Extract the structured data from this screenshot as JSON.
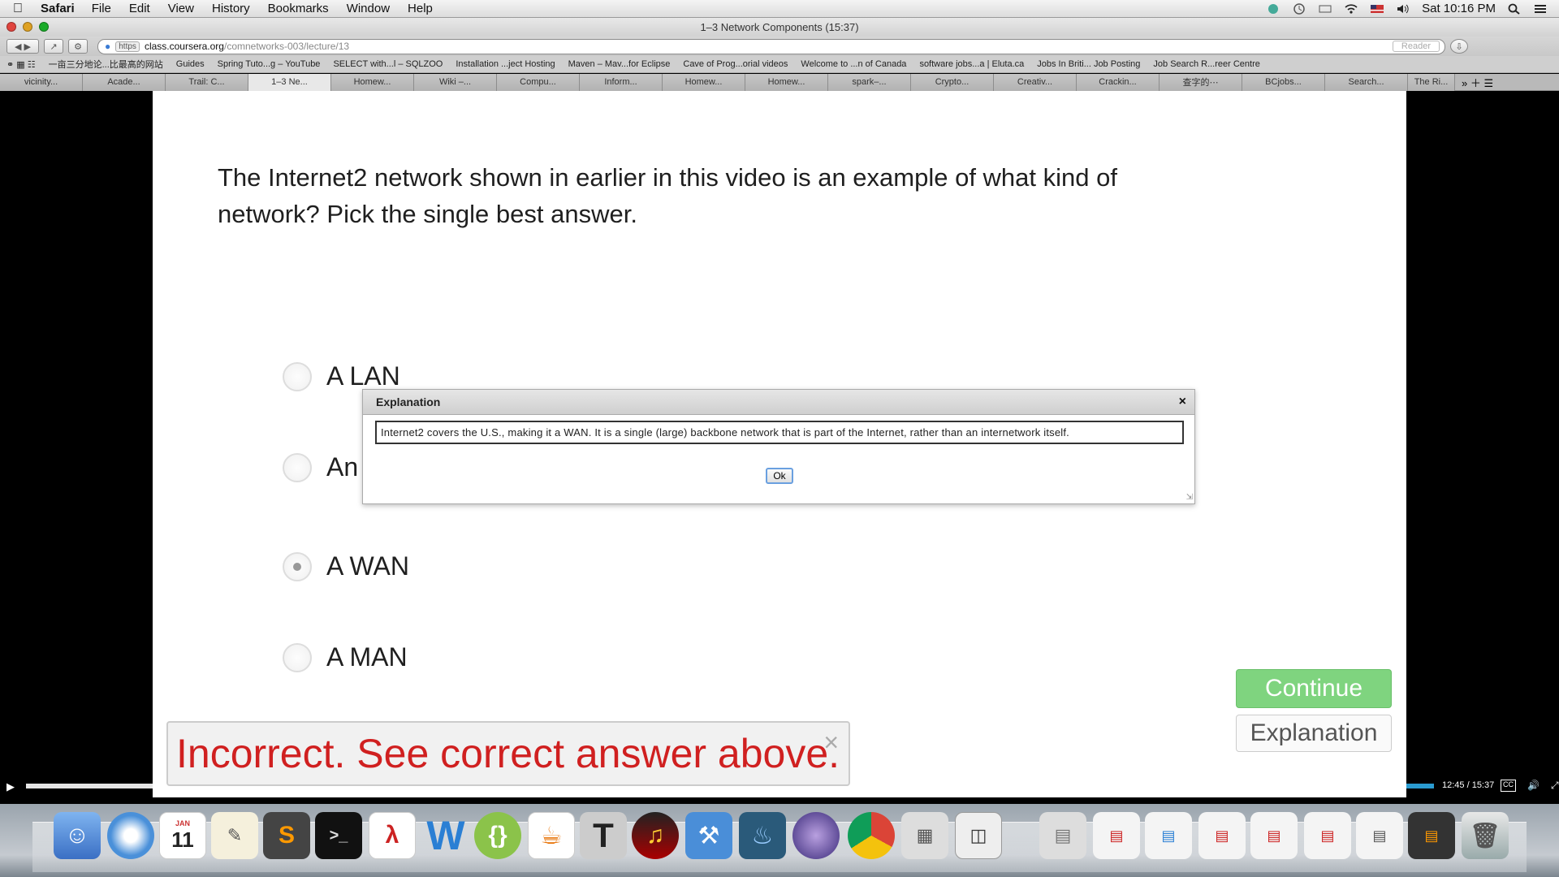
{
  "menubar": {
    "app_name": "Safari",
    "items": [
      "File",
      "Edit",
      "View",
      "History",
      "Bookmarks",
      "Window",
      "Help"
    ],
    "clock": "Sat 10:16 PM"
  },
  "window": {
    "title": "1–3 Network Components (15:37)"
  },
  "toolbar": {
    "url_scheme": "https",
    "url_host": "class.coursera.org",
    "url_path": "/comnetworks-003/lecture/13",
    "reader_label": "Reader"
  },
  "bookmarks": [
    "一亩三分地论...比最高的网站",
    "Guides",
    "Spring Tuto...g – YouTube",
    "SELECT with...l – SQLZOO",
    "Installation ...ject Hosting",
    "Maven – Mav...for Eclipse",
    "Cave of Prog...orial videos",
    "Welcome to ...n of Canada",
    "software jobs...a | Eluta.ca",
    "Jobs In Briti... Job Posting",
    "Job Search R...reer Centre"
  ],
  "tabs": [
    "vicinity...",
    "Acade...",
    "Trail: C...",
    "1–3 Ne...",
    "Homew...",
    "Wiki –...",
    "Compu...",
    "Inform...",
    "Homew...",
    "Homew...",
    "spark–...",
    "Crypto...",
    "Creativ...",
    "Crackin...",
    "查字的⋯",
    "BCjobs...",
    "Search...",
    "The Ri..."
  ],
  "quiz": {
    "question": "The Internet2 network shown in earlier in this video is an example of what kind of network? Pick the single best answer.",
    "options": [
      {
        "label": "A LAN",
        "selected": false
      },
      {
        "label": "An",
        "selected": false
      },
      {
        "label": "A WAN",
        "selected": true
      },
      {
        "label": "A MAN",
        "selected": false
      }
    ],
    "continue_label": "Continue",
    "explanation_label": "Explanation",
    "feedback": "Incorrect. See correct answer above.",
    "feedback_close": "×"
  },
  "dialog": {
    "title": "Explanation",
    "close": "×",
    "text": "Internet2 covers the U.S., making it a WAN. It is a single (large) backbone network that is part of the Internet, rather than an internetwork itself.",
    "ok_label": "Ok"
  },
  "video": {
    "time": "12:45 / 15:37",
    "progress": 0.815
  },
  "dock": {
    "calendar_month": "JAN",
    "calendar_day": "11"
  }
}
